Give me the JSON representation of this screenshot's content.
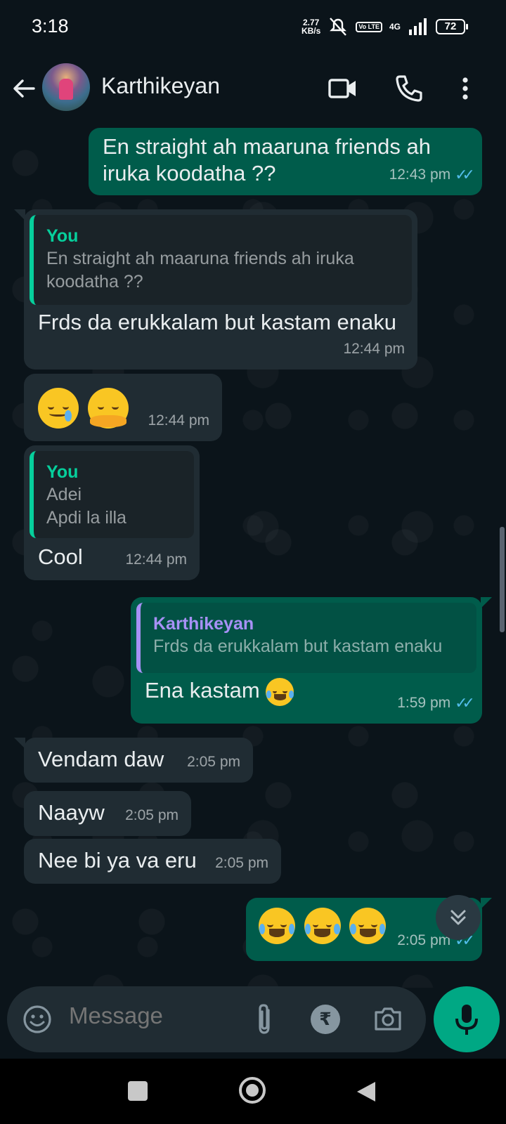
{
  "status_bar": {
    "time": "3:18",
    "net_speed_value": "2.77",
    "net_speed_unit": "KB/s",
    "volte": "Vo LTE",
    "network": "4G",
    "battery": "72"
  },
  "header": {
    "contact_name": "Karthikeyan"
  },
  "messages": [
    {
      "dir": "out",
      "text": "En straight ah maaruna friends ah iruka koodatha ??",
      "time": "12:43 pm"
    },
    {
      "dir": "in",
      "quote_author": "You",
      "quote_text": "En straight ah maaruna friends ah iruka koodatha ??",
      "text": "Frds da erukkalam but kastam enaku",
      "time": "12:44 pm"
    },
    {
      "dir": "in",
      "emojis": [
        "smiling-face-with-tear",
        "hugging-face"
      ],
      "time": "12:44 pm"
    },
    {
      "dir": "in",
      "quote_author": "You",
      "quote_line1": "Adei",
      "quote_line2": "Apdi la illa",
      "text": "Cool",
      "time": "12:44 pm"
    },
    {
      "dir": "out",
      "quote_author": "Karthikeyan",
      "quote_text": "Frds da erukkalam but kastam enaku",
      "text": "Ena kastam",
      "emojis": [
        "face-with-tears-of-joy"
      ],
      "time": "1:59 pm"
    },
    {
      "dir": "in",
      "text": "Vendam daw",
      "time": "2:05 pm"
    },
    {
      "dir": "in",
      "text": "Naayw",
      "time": "2:05 pm"
    },
    {
      "dir": "in",
      "text": "Nee bi ya va eru",
      "time": "2:05 pm"
    },
    {
      "dir": "out",
      "emojis": [
        "face-with-tears-of-joy",
        "face-with-tears-of-joy",
        "face-with-tears-of-joy"
      ],
      "time": "2:05 pm"
    }
  ],
  "composer": {
    "placeholder": "Message",
    "rupee_symbol": "₹"
  },
  "colors": {
    "background": "#0b141a",
    "incoming_bubble": "#202c33",
    "outgoing_bubble": "#005c4b",
    "accent_green": "#00a884",
    "read_ticks": "#53bdeb",
    "quote_self": "#06cf9c",
    "quote_contact": "#a791f6"
  }
}
